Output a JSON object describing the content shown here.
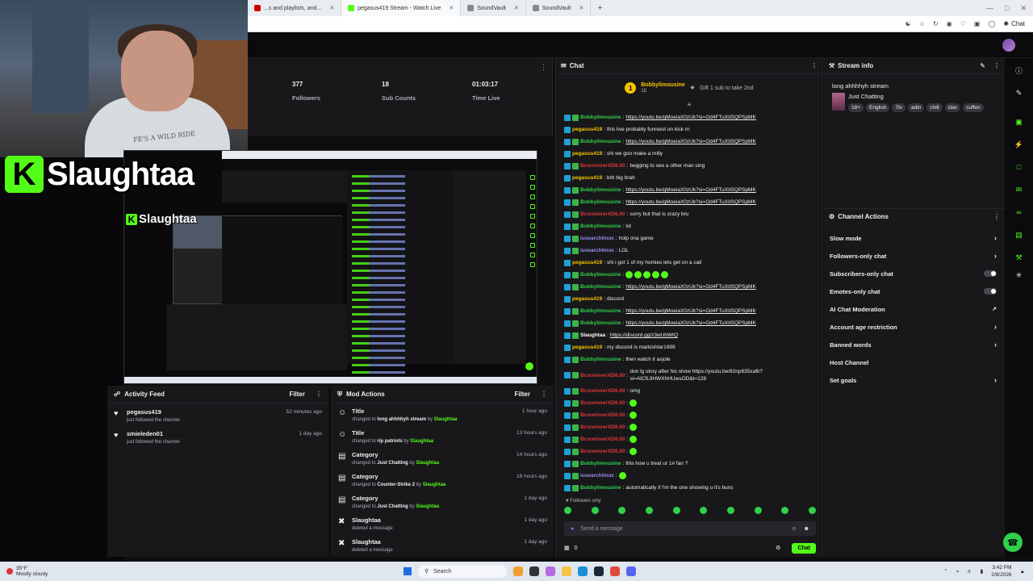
{
  "browser": {
    "tabs": [
      {
        "label": "...s and playlists, and...",
        "color": "#cc0000"
      },
      {
        "label": "pegasus419 Stream - Watch Live",
        "color": "#53fc18"
      },
      {
        "label": "SoundVault",
        "color": "#888888"
      },
      {
        "label": "SoundVault",
        "color": "#888888"
      }
    ],
    "new_tab": "+",
    "chat_label": "Chat"
  },
  "overlay": {
    "brand_letter": "K",
    "brand_name": "Slaughtaa",
    "hoodie_text": "FE'S A WILD RIDE"
  },
  "stats": [
    {
      "value": "377",
      "label": "Followers"
    },
    {
      "value": "18",
      "label": "Sub Counts"
    },
    {
      "value": "01:03:17",
      "label": "Time Live"
    }
  ],
  "activity_feed": {
    "title": "Activity Feed",
    "filter": "Filter",
    "items": [
      {
        "name": "pegasus419",
        "sub": "just followed the channel",
        "time": "52 minutes ago"
      },
      {
        "name": "smieleden01",
        "sub": "just followed the channel",
        "time": "1 day ago"
      }
    ]
  },
  "mod_actions": {
    "title": "Mod Actions",
    "filter": "Filter",
    "items": [
      {
        "icon": "person-icon",
        "name": "Title",
        "pre": "changed to ",
        "value": "long ahhhhyh stream",
        "by": "Slaughtaa",
        "time": "1 hour ago"
      },
      {
        "icon": "person-icon",
        "name": "Title",
        "pre": "changed to ",
        "value": "rip patriots",
        "by": "Slaughtaa",
        "time": "13 hours ago"
      },
      {
        "icon": "category-icon",
        "name": "Category",
        "pre": "changed to ",
        "value": "Just Chatting",
        "by": "Slaughtaa",
        "time": "14 hours ago"
      },
      {
        "icon": "category-icon",
        "name": "Category",
        "pre": "changed to ",
        "value": "Counter-Strike 2",
        "by": "Slaughtaa",
        "time": "16 hours ago"
      },
      {
        "icon": "category-icon",
        "name": "Category",
        "pre": "changed to ",
        "value": "Just Chatting",
        "by": "Slaughtaa",
        "time": "1 day ago"
      },
      {
        "icon": "trash-icon",
        "name": "Slaughtaa",
        "pre": "deleted a message",
        "value": "",
        "by": "",
        "time": "1 day ago"
      },
      {
        "icon": "trash-icon",
        "name": "Slaughtaa",
        "pre": "deleted a message",
        "value": "",
        "by": "",
        "time": "1 day ago"
      }
    ]
  },
  "chat": {
    "title": "Chat",
    "pinned": {
      "rank": "1",
      "name": "Bobbylimousine",
      "count": "15",
      "tip": "Gift 1 sub to take 2nd"
    },
    "messages": [
      {
        "user": "Bobbylimousine",
        "color": "#2fd14a",
        "text": "https://youtu.be/gMoeiaX0zUk?si=Od4FTuXitSQPSpMK",
        "link": true
      },
      {
        "user": "pegasus419",
        "color": "#f5c400",
        "text": "this live probably funniest on kick rn",
        "link": false
      },
      {
        "user": "Bobbylimousine",
        "color": "#2fd14a",
        "text": "https://youtu.be/gMoeiaX0zUk?si=Od4FTuXitSQPSpMK",
        "link": true
      },
      {
        "user": "pegasus419",
        "color": "#f5c400",
        "text": "shi we gon make a milly",
        "link": false
      },
      {
        "user": "BruceloverXD6.00",
        "color": "#e03636",
        "text": "begging to see a other man sing",
        "link": false
      },
      {
        "user": "pegasus419",
        "color": "#f5c400",
        "text": "brb big brah",
        "link": false
      },
      {
        "user": "Bobbylimousine",
        "color": "#2fd14a",
        "text": "https://youtu.be/gMoeiaX0zUk?si=Od4FTuXitSQPSpMK",
        "link": true
      },
      {
        "user": "Bobbylimousine",
        "color": "#2fd14a",
        "text": "https://youtu.be/gMoeiaX0zUk?si=Od4FTuXitSQPSpMK",
        "link": true
      },
      {
        "user": "BruceloverXD6.00",
        "color": "#e03636",
        "text": "sorry but that is crazy bru",
        "link": false
      },
      {
        "user": "Bobbylimousine",
        "color": "#2fd14a",
        "text": "lol",
        "link": false
      },
      {
        "user": "iusearchlinux",
        "color": "#9b8df0",
        "text": "holp ona game",
        "link": false
      },
      {
        "user": "iusearchlinux",
        "color": "#9b8df0",
        "text": "LOL",
        "link": false
      },
      {
        "user": "pegasus419",
        "color": "#f5c400",
        "text": "shi i got 1 of my homies lets get on a call",
        "link": false
      },
      {
        "user": "Bobbylimousine",
        "color": "#2fd14a",
        "text": "",
        "link": false,
        "emotes": 5
      },
      {
        "user": "Bobbylimousine",
        "color": "#2fd14a",
        "text": "https://youtu.be/gMoeiaX0zUk?si=Od4FTuXitSQPSpMK",
        "link": true
      },
      {
        "user": "pegasus419",
        "color": "#f5c400",
        "text": "discord",
        "link": false
      },
      {
        "user": "Bobbylimousine",
        "color": "#2fd14a",
        "text": "https://youtu.be/gMoeiaX0zUk?si=Od4FTuXitSQPSpMK",
        "link": true
      },
      {
        "user": "Bobbylimousine",
        "color": "#2fd14a",
        "text": "https://youtu.be/gMoeiaX0zUk?si=Od4FTuXitSQPSpMK",
        "link": true
      },
      {
        "user": "Slaughtaa",
        "color": "#ffffff",
        "text": "https://discord.gg/z3wUbWtQ",
        "link": true
      },
      {
        "user": "pegasus419",
        "color": "#f5c400",
        "text": "my discord is markishtar1999",
        "link": false
      },
      {
        "user": "Bobbylimousine",
        "color": "#2fd14a",
        "text": "then watch it asjole",
        "link": false
      },
      {
        "user": "BruceloverXD6.00",
        "color": "#e03636",
        "text": "don lg story after his show https://youtu.be/82np835xafk?si=AlCfL9HWXhHUwsOD&t=128",
        "link": false,
        "tall": true
      },
      {
        "user": "BruceloverXD6.00",
        "color": "#e03636",
        "text": "omg",
        "link": false
      },
      {
        "user": "BruceloverXD6.00",
        "color": "#e03636",
        "text": "",
        "link": false,
        "emotes": 1
      },
      {
        "user": "BruceloverXD6.00",
        "color": "#e03636",
        "text": "",
        "link": false,
        "emotes": 1
      },
      {
        "user": "BruceloverXD6.00",
        "color": "#e03636",
        "text": "",
        "link": false,
        "emotes": 1
      },
      {
        "user": "BruceloverXD6.00",
        "color": "#e03636",
        "text": "",
        "link": false,
        "emotes": 1
      },
      {
        "user": "BruceloverXD6.00",
        "color": "#e03636",
        "text": "",
        "link": false,
        "emotes": 1
      },
      {
        "user": "Bobbylimousine",
        "color": "#2fd14a",
        "text": "this how u treat ur 1# fan ?",
        "link": false
      },
      {
        "user": "iusearchlinux",
        "color": "#9b8df0",
        "text": "",
        "link": false,
        "emotes": 1
      },
      {
        "user": "Bobbylimousine",
        "color": "#2fd14a",
        "text": "automatically if I'm the one showing u it's buns",
        "link": false
      }
    ],
    "followers_only": "Followers only",
    "input_placeholder": "Send a message",
    "viewer_count": "0",
    "send_label": "Chat"
  },
  "stream_info": {
    "title": "Stream info",
    "stream_title": "long ahhhhyh stream",
    "category": "Just Chatting",
    "tags": [
      "18+",
      "English",
      "7tv",
      "adin",
      "chill",
      "clav",
      "cuffen"
    ]
  },
  "channel_actions": {
    "title": "Channel Actions",
    "items": [
      {
        "label": "Slow mode",
        "control": "chevron"
      },
      {
        "label": "Followers-only chat",
        "control": "chevron"
      },
      {
        "label": "Subscribers-only chat",
        "control": "toggle"
      },
      {
        "label": "Emotes-only chat",
        "control": "toggle"
      },
      {
        "label": "AI Chat Moderation",
        "control": "external"
      },
      {
        "label": "Account age restriction",
        "control": "chevron"
      },
      {
        "label": "Banned words",
        "control": "chevron"
      },
      {
        "label": "Host Channel",
        "control": "none"
      },
      {
        "label": "Set goals",
        "control": "chevron"
      }
    ]
  },
  "taskbar": {
    "weather_temp": "35°F",
    "weather_desc": "Mostly cloudy",
    "search_placeholder": "Search",
    "time": "3:42 PM",
    "date": "2/8/2026"
  },
  "colors": {
    "accent": "#53fc18",
    "panel": "#18181b",
    "bg": "#0e0e10"
  }
}
